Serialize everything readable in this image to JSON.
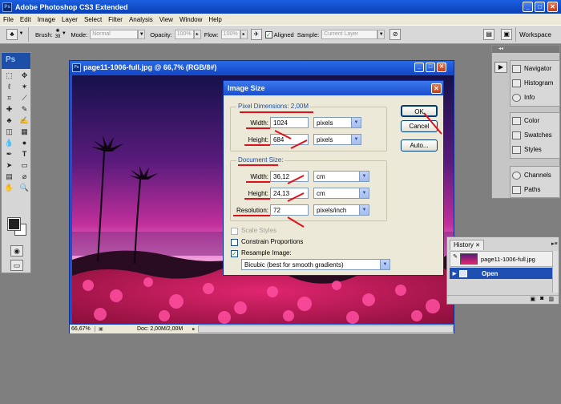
{
  "app": {
    "title": "Adobe Photoshop CS3 Extended",
    "logo": "Ps"
  },
  "menu": [
    "File",
    "Edit",
    "Image",
    "Layer",
    "Select",
    "Filter",
    "Analysis",
    "View",
    "Window",
    "Help"
  ],
  "options_bar": {
    "brush_label": "Brush:",
    "brush_size": "39",
    "mode_label": "Mode:",
    "mode_value": "Normal",
    "opacity_label": "Opacity:",
    "opacity_value": "100%",
    "flow_label": "Flow:",
    "flow_value": "100%",
    "aligned_label": "Aligned",
    "sample_label": "Sample:",
    "sample_value": "Current Layer",
    "workspace_label": "Workspace"
  },
  "document": {
    "title": "page11-1006-full.jpg @ 66,7% (RGB/8#)",
    "zoom": "66,67%",
    "doc_info": "Doc: 2,00M/2,00M"
  },
  "dialog": {
    "title": "Image Size",
    "pixel_dimensions_label": "Pixel Dimensions: 2,00M",
    "pixel_width_label": "Width:",
    "pixel_width_value": "1024",
    "pixel_width_unit": "pixels",
    "pixel_height_label": "Height:",
    "pixel_height_value": "684",
    "pixel_height_unit": "pixels",
    "document_size_label": "Document Size:",
    "doc_width_label": "Width:",
    "doc_width_value": "36,12",
    "doc_width_unit": "cm",
    "doc_height_label": "Height:",
    "doc_height_value": "24,13",
    "doc_height_unit": "cm",
    "resolution_label": "Resolution:",
    "resolution_value": "72",
    "resolution_unit": "pixels/inch",
    "scale_styles": "Scale Styles",
    "constrain": "Constrain Proportions",
    "resample": "Resample Image:",
    "resample_method": "Bicubic (best for smooth gradients)",
    "ok": "OK",
    "cancel": "Cancel",
    "auto": "Auto..."
  },
  "panels": {
    "group1": [
      "Navigator",
      "Histogram",
      "Info"
    ],
    "group2": [
      "Color",
      "Swatches",
      "Styles"
    ],
    "group3": [
      "Channels",
      "Paths"
    ]
  },
  "history": {
    "tab": "History",
    "snapshot": "page11-1006-full.jpg",
    "state": "Open"
  },
  "colors": {
    "accent": "#1d4ea8",
    "annotation_red": "#e0101a",
    "xp_blue": "#1a4fcf"
  }
}
